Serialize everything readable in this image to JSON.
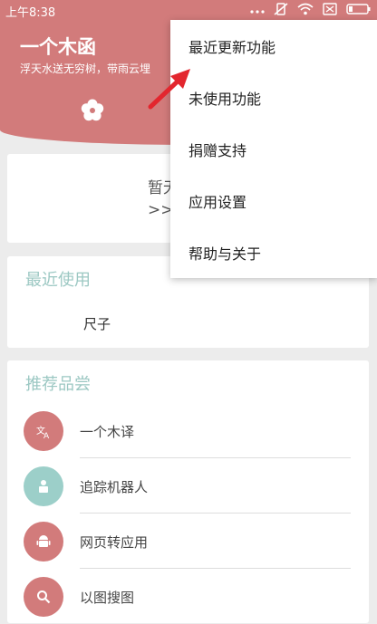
{
  "status": {
    "time": "上午8:38"
  },
  "header": {
    "title": "一个木函",
    "subtitle": "浮天水送无穷树，带雨云埋"
  },
  "empty_card": {
    "line1": "暂无",
    "line2": ">>>"
  },
  "recent": {
    "title": "最近使用",
    "items": [
      "尺子"
    ]
  },
  "recommend": {
    "title": "推荐品尝",
    "items": [
      {
        "label": "一个木译",
        "icon": "translate-icon",
        "color": "#d27b7b"
      },
      {
        "label": "追踪机器人",
        "icon": "robot-person-icon",
        "color": "#9ccfc9"
      },
      {
        "label": "网页转应用",
        "icon": "android-icon",
        "color": "#d27b7b"
      },
      {
        "label": "以图搜图",
        "icon": "search-icon",
        "color": "#d27b7b"
      }
    ]
  },
  "menu": {
    "items": [
      "最近更新功能",
      "未使用功能",
      "捐赠支持",
      "应用设置",
      "帮助与关于"
    ]
  },
  "colors": {
    "header": "#d27b7b",
    "section_title": "#9cc8c3",
    "arrow": "#e3262e"
  }
}
